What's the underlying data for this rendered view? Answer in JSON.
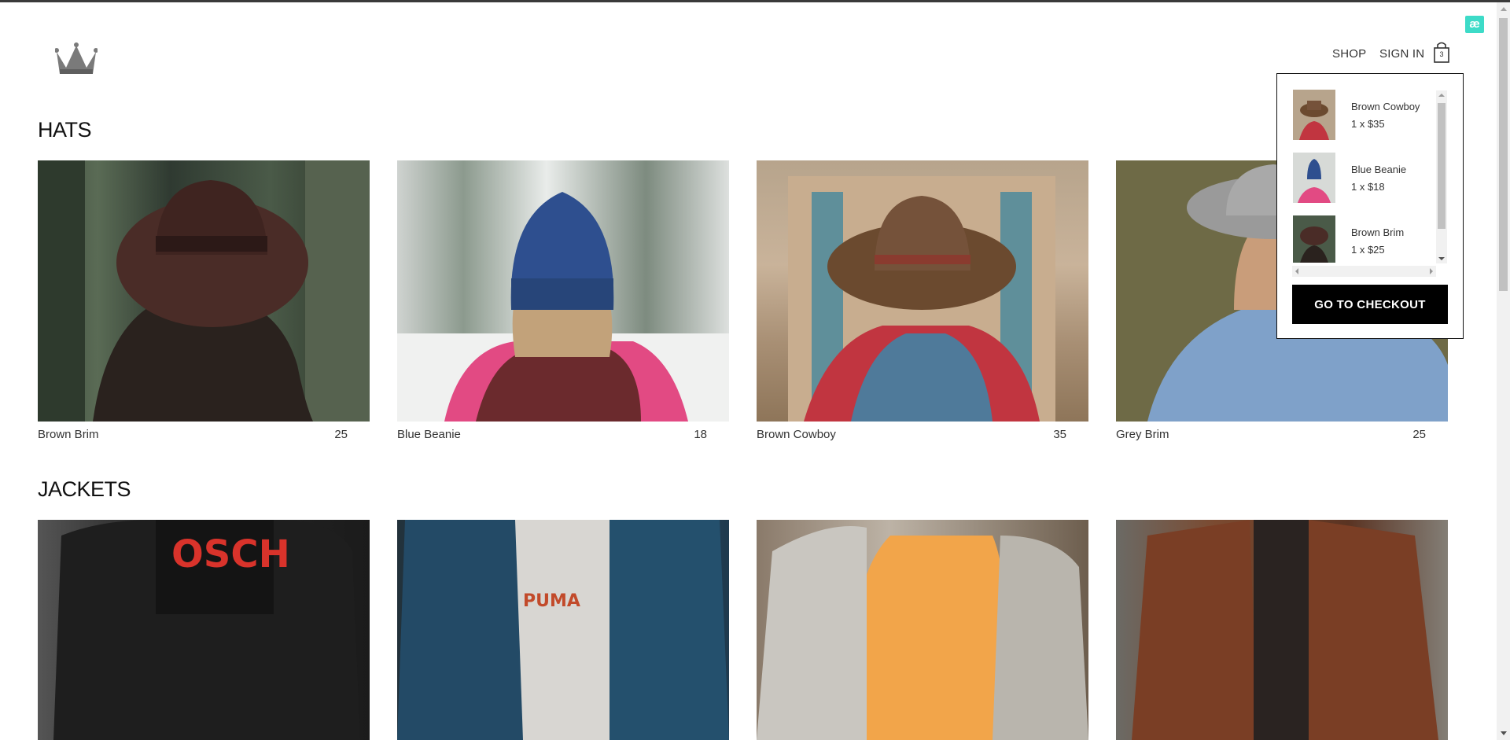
{
  "nav": {
    "shop": "SHOP",
    "sign_in": "SIGN IN",
    "cart_count": "3"
  },
  "badge": {
    "label": "æ"
  },
  "sections": [
    {
      "title": "HATS",
      "items": [
        {
          "name": "Brown Brim",
          "price": "25"
        },
        {
          "name": "Blue Beanie",
          "price": "18"
        },
        {
          "name": "Brown Cowboy",
          "price": "35"
        },
        {
          "name": "Grey Brim",
          "price": "25"
        }
      ]
    },
    {
      "title": "JACKETS"
    }
  ],
  "cart": {
    "items": [
      {
        "name": "Brown Cowboy",
        "qty": "1 x $35"
      },
      {
        "name": "Blue Beanie",
        "qty": "1 x $18"
      },
      {
        "name": "Brown Brim",
        "qty": "1 x $25"
      }
    ],
    "checkout_label": "GO TO CHECKOUT"
  },
  "icons": {
    "logo": "crown-icon",
    "cart": "shopping-bag-icon"
  },
  "colors": {
    "accent_badge": "#3ddbc8",
    "checkout_bg": "#000000"
  }
}
